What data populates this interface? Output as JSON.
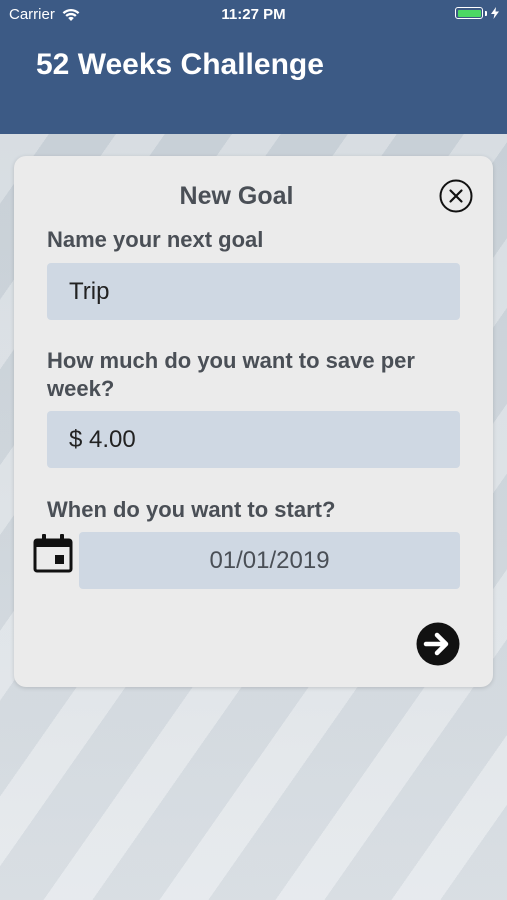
{
  "status_bar": {
    "carrier": "Carrier",
    "time": "11:27 PM",
    "wifi_icon": "wifi-icon",
    "battery_icon": "battery-icon",
    "charging_icon": "bolt-icon",
    "battery_color": "#4cd964"
  },
  "header": {
    "title": "52 Weeks Challenge",
    "background_color": "#3c5a85"
  },
  "dialog": {
    "title": "New Goal",
    "close_icon": "close-circle-icon",
    "name_field": {
      "label": "Name your next goal",
      "value": "Trip"
    },
    "amount_field": {
      "label": "How much do you want to save per week?",
      "value": "$ 4.00"
    },
    "start_field": {
      "label": "When do you want to start?",
      "calendar_icon": "calendar-icon",
      "value": "01/01/2019"
    },
    "next_icon": "arrow-right-circle-icon"
  }
}
